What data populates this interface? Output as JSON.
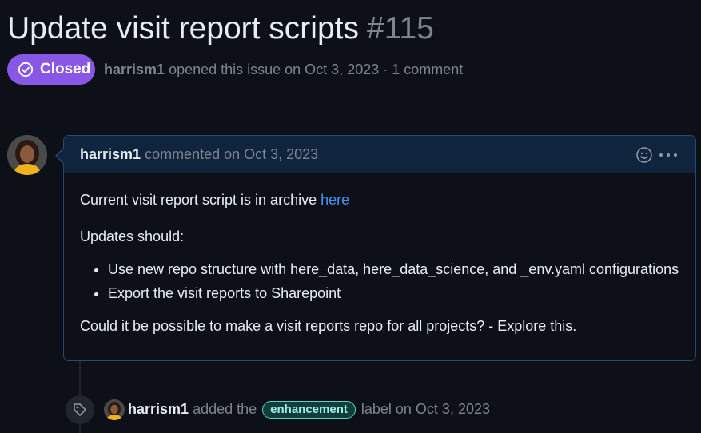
{
  "issue": {
    "title": "Update visit report scripts",
    "number": "#115",
    "state": "Closed",
    "state_color": "#8957e5",
    "author": "harrism1",
    "opened_text": "opened this issue on Oct 3, 2023 · 1 comment"
  },
  "comment": {
    "author": "harrism1",
    "meta": "commented on Oct 3, 2023",
    "body_line1": "Current visit report script is in archive ",
    "body_link": "here",
    "body_line2": "Updates should:",
    "bullets": [
      "Use new repo structure with here_data, here_data_science, and _env.yaml configurations",
      "Export the visit reports to Sharepoint"
    ],
    "body_line3": "Could it be possible to make a visit reports repo for all projects? - Explore this.",
    "icons": [
      "smiley-icon",
      "kebab-menu-icon"
    ]
  },
  "event": {
    "author": "harrism1",
    "action": "added the",
    "label": "enhancement",
    "suffix": "label on Oct 3, 2023",
    "label_color": "#56d4c2",
    "icon": "tag-icon"
  }
}
